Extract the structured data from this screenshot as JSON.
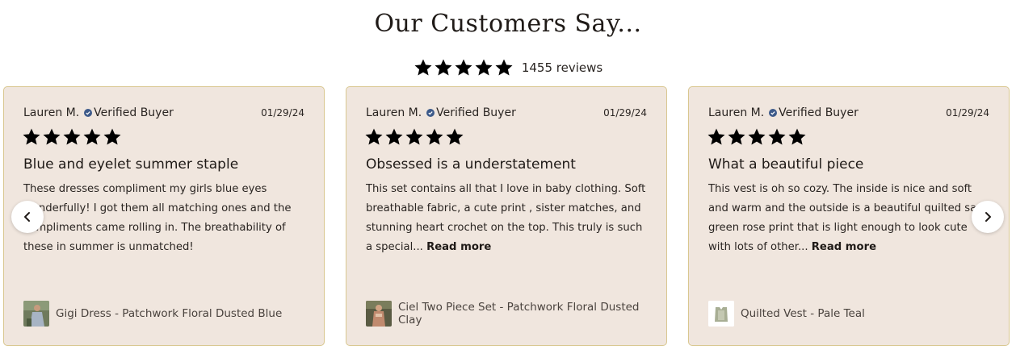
{
  "section": {
    "title": "Our Customers Say..."
  },
  "summary": {
    "rating": 5,
    "count_text": "1455 reviews"
  },
  "colors": {
    "star": "#d9c790",
    "card_bg": "#f0e6de",
    "card_border": "#d9c790",
    "verified": "#3d5a8a"
  },
  "reviews": [
    {
      "author": "Lauren M.",
      "badge": "Verified Buyer",
      "date": "01/29/24",
      "rating": 5,
      "title": "Blue and eyelet summer staple",
      "body": "These dresses compliment my girls blue eyes wonderfully! I got them all matching ones and the compliments came rolling in. The breathability of these in summer is unmatched!",
      "read_more": "",
      "product": "Gigi Dress - Patchwork Floral Dusted Blue"
    },
    {
      "author": "Lauren M.",
      "badge": "Verified Buyer",
      "date": "01/29/24",
      "rating": 5,
      "title": "Obsessed is a understatement",
      "body": "This set contains all that I love in baby clothing. Soft breathable fabric, a cute print , sister matches, and stunning heart crochet on the top. This truly is such a special... ",
      "read_more": "Read more",
      "product": "Ciel Two Piece Set - Patchwork Floral Dusted Clay"
    },
    {
      "author": "Lauren M.",
      "badge": "Verified Buyer",
      "date": "01/29/24",
      "rating": 5,
      "title": "What a beautiful piece",
      "body": "This vest is oh so cozy. The inside is nice and soft and warm and the outside is a beautiful quilted sage green rose print that is light enough to look cute with lots of other... ",
      "read_more": "Read more",
      "product": "Quilted Vest - Pale Teal"
    }
  ],
  "nav": {
    "prev_icon": "chevron-left-icon",
    "next_icon": "chevron-right-icon"
  }
}
